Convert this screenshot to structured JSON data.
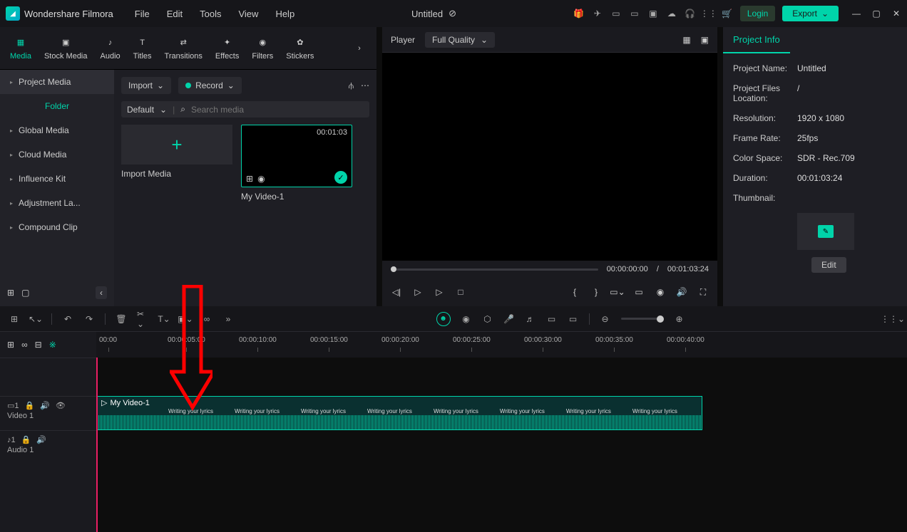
{
  "app": {
    "title": "Wondershare Filmora"
  },
  "menu": [
    "File",
    "Edit",
    "Tools",
    "View",
    "Help"
  ],
  "document": {
    "title": "Untitled"
  },
  "titlebar": {
    "login": "Login",
    "export": "Export"
  },
  "tabs": [
    "Media",
    "Stock Media",
    "Audio",
    "Titles",
    "Transitions",
    "Effects",
    "Filters",
    "Stickers"
  ],
  "sidebar": {
    "items": [
      "Project Media",
      "Folder",
      "Global Media",
      "Cloud Media",
      "Influence Kit",
      "Adjustment La...",
      "Compound Clip"
    ]
  },
  "toolbar": {
    "import": "Import",
    "record": "Record"
  },
  "filter": {
    "default": "Default",
    "placeholder": "Search media"
  },
  "media": {
    "import_label": "Import Media",
    "clip1_duration": "00:01:03",
    "clip1_name": "My Video-1"
  },
  "player": {
    "label": "Player",
    "quality": "Full Quality",
    "time_current": "00:00:00:00",
    "time_sep": "/",
    "time_total": "00:01:03:24"
  },
  "project_info": {
    "tab": "Project Info",
    "rows": {
      "name_label": "Project Name:",
      "name_val": "Untitled",
      "loc_label": "Project Files Location:",
      "loc_val": "/",
      "res_label": "Resolution:",
      "res_val": "1920 x 1080",
      "fps_label": "Frame Rate:",
      "fps_val": "25fps",
      "cs_label": "Color Space:",
      "cs_val": "SDR - Rec.709",
      "dur_label": "Duration:",
      "dur_val": "00:01:03:24",
      "thumb_label": "Thumbnail:"
    },
    "edit": "Edit"
  },
  "ruler": [
    "00:00",
    "00:00:05:00",
    "00:00:10:00",
    "00:00:15:00",
    "00:00:20:00",
    "00:00:25:00",
    "00:00:30:00",
    "00:00:35:00",
    "00:00:40:00"
  ],
  "tracks": {
    "video1": "Video 1",
    "audio1": "Audio 1",
    "clip_name": "My Video-1",
    "lyric": "Writing your lyrics"
  }
}
